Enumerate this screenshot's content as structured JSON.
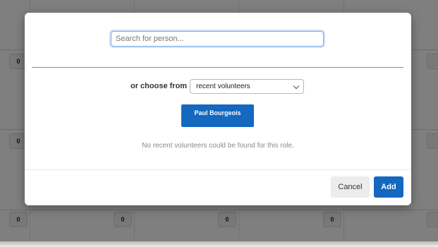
{
  "background": {
    "badge_value": "0"
  },
  "dialog": {
    "search": {
      "placeholder": "Search for person...",
      "value": ""
    },
    "choose_label": "or choose from",
    "choose_select": {
      "selected": "recent volunteers",
      "icon": "chevron-down-icon"
    },
    "person_button_label": "Paul Bourgeois",
    "empty_message": "No recent volunteers could be found for this role.",
    "cancel_label": "Cancel",
    "add_label": "Add"
  },
  "colors": {
    "primary": "#1468c0",
    "focus_ring": "#7fb0e6",
    "cancel_bg": "#ececec",
    "muted_text": "#8a8a8a"
  }
}
